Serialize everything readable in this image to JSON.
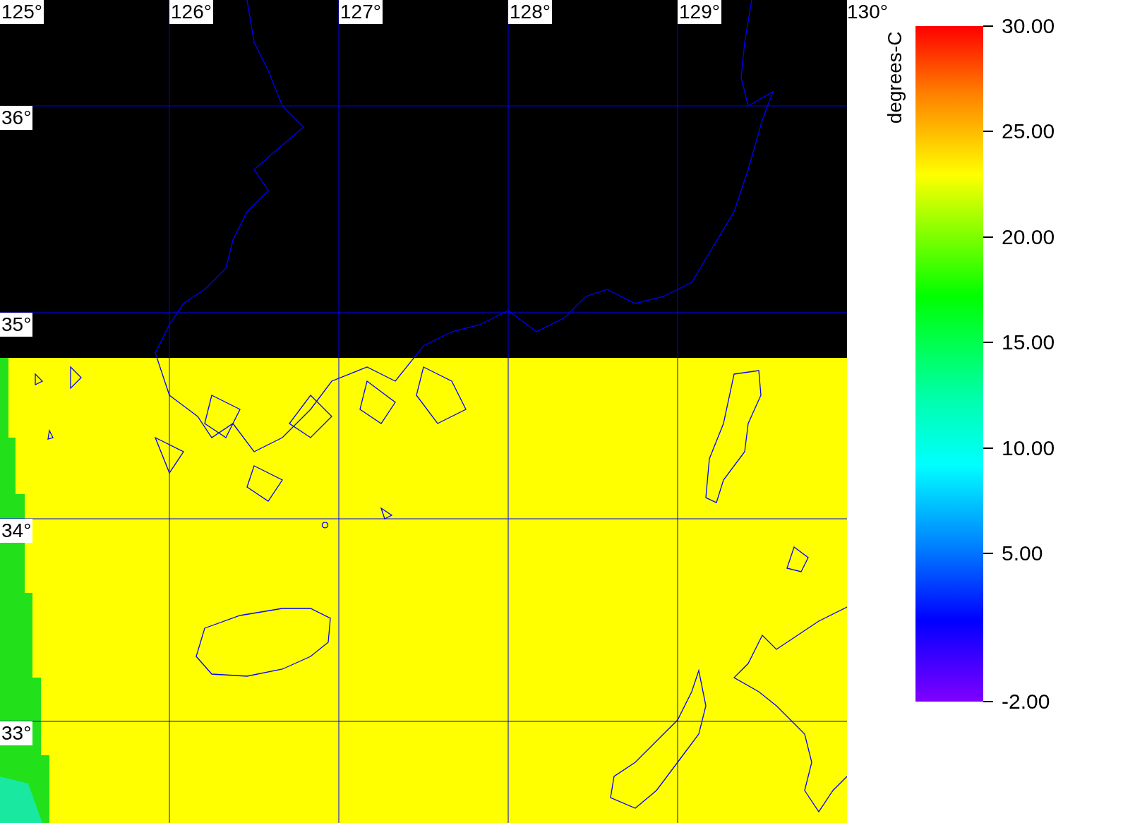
{
  "map": {
    "lon_labels": [
      "125°",
      "126°",
      "127°",
      "128°",
      "129°"
    ],
    "lat_labels": [
      "36°",
      "35°",
      "34°",
      "33°"
    ]
  },
  "axis_end_label": "130°",
  "colorbar": {
    "title": "degrees-C",
    "ticks": [
      "30.00",
      "25.00",
      "20.00",
      "15.00",
      "10.00",
      "5.00",
      "-2.00"
    ]
  }
}
